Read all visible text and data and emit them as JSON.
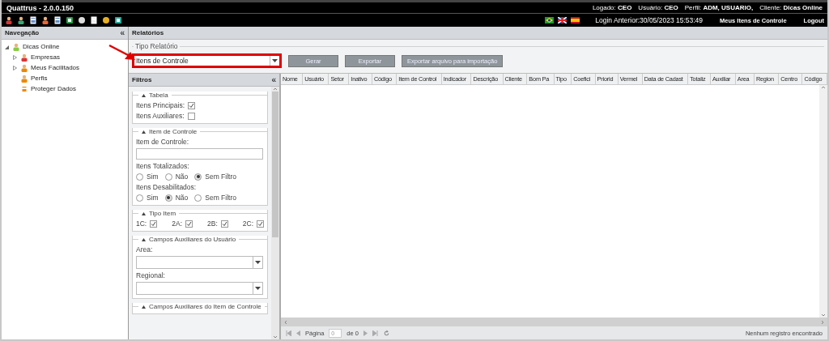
{
  "title_bar": {
    "title": "Quattrus - 2.0.0.150",
    "session": [
      {
        "label": "Logado:",
        "value": "CEO"
      },
      {
        "label": "Usuário:",
        "value": "CEO"
      },
      {
        "label": "Perfil:",
        "value": "ADM, USUARIO,"
      },
      {
        "label": "Cliente:",
        "value": "Dicas Online"
      }
    ]
  },
  "toolbar": {
    "login_previous": "Login Anterior:30/05/2023 15:53:49",
    "links": [
      "Meus Itens de Controle",
      "Logout"
    ]
  },
  "navigation": {
    "title": "Navegação",
    "collapse": "«",
    "tree": [
      {
        "label": "Dicas Online",
        "expanded": true,
        "children": [
          {
            "label": "Empresas",
            "expanded": false
          },
          {
            "label": "Meus Facilitados",
            "expanded": false
          },
          {
            "label": "Perfis"
          },
          {
            "label": "Proteger Dados"
          }
        ]
      }
    ]
  },
  "reports": {
    "title": "Relatórios",
    "group": "Tipo Relatório",
    "report_type": "Itens de Controle",
    "buttons": [
      "Gerar",
      "Exportar",
      "Exportar arquivo para importação"
    ]
  },
  "filters": {
    "title": "Filtros",
    "collapse": "«",
    "sections": [
      {
        "title": "Tabela",
        "fields": [
          {
            "kind": "checkbox",
            "label": "Itens Principais:",
            "checked": true
          },
          {
            "kind": "checkbox",
            "label": "Itens Auxiliares:",
            "checked": false
          }
        ]
      },
      {
        "title": "Item de Controle",
        "fields": [
          {
            "kind": "text",
            "label": "Item de Controle:"
          },
          {
            "kind": "radio",
            "label": "Itens Totalizados:",
            "options": [
              {
                "label": "Sim",
                "selected": false
              },
              {
                "label": "Não",
                "selected": false
              },
              {
                "label": "Sem Filtro",
                "selected": true
              }
            ]
          },
          {
            "kind": "radio",
            "label": "Itens Desabilitados:",
            "options": [
              {
                "label": "Sim",
                "selected": false
              },
              {
                "label": "Não",
                "selected": true
              },
              {
                "label": "Sem Filtro",
                "selected": false
              }
            ]
          }
        ]
      },
      {
        "title": "Tipo Item",
        "fields": [
          {
            "kind": "checkrow",
            "items": [
              {
                "label": "1C:",
                "checked": true
              },
              {
                "label": "2A:",
                "checked": true
              },
              {
                "label": "2B:",
                "checked": true
              },
              {
                "label": "2C:",
                "checked": true
              }
            ]
          }
        ]
      },
      {
        "title": "Campos Auxiliares do Usuário",
        "fields": [
          {
            "kind": "select",
            "label": "Area:"
          },
          {
            "kind": "select",
            "label": "Regional:"
          }
        ]
      },
      {
        "title": "Campos Auxiliares do Item de Controle"
      }
    ]
  },
  "grid": {
    "columns": [
      "Nome",
      "Usuário",
      "Setor",
      "Inativo",
      "Código",
      "Item de Control",
      "Indicador",
      "Descrição",
      "Cliente",
      "Bom Pa",
      "Tipo",
      "Coefici",
      "Priorid",
      "Vermel",
      "Data de Cadast",
      "Totaliz",
      "Auxiliar",
      "Area",
      "Region",
      "Centro",
      "Código"
    ]
  },
  "pager": {
    "page_label": "Página",
    "page_value": "0",
    "page_of": "de 0",
    "status": "Nenhum registro encontrado"
  }
}
